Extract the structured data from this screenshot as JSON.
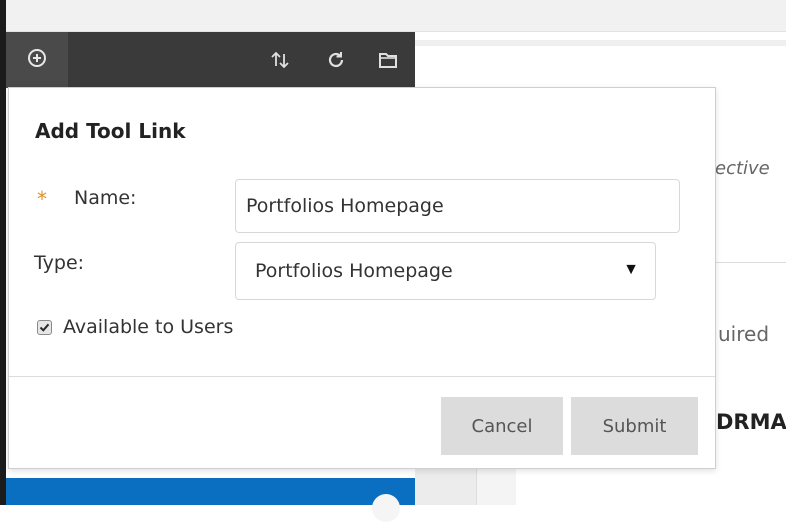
{
  "toolbar": {
    "icons": [
      "add-circle-icon",
      "sort-arrows-icon",
      "refresh-icon",
      "folder-icon"
    ]
  },
  "background_page": {
    "text_fragment_1": "ective",
    "text_fragment_2": "uired",
    "text_fragment_3": "DRMA"
  },
  "dialog": {
    "title": "Add Tool Link",
    "name_field": {
      "required_marker": "*",
      "label": "Name:",
      "value": "Portfolios Homepage"
    },
    "type_field": {
      "label": "Type:",
      "selected": "Portfolios Homepage",
      "arrow": "▼"
    },
    "available_checkbox": {
      "label": "Available to Users",
      "checked": true
    },
    "buttons": {
      "cancel": "Cancel",
      "submit": "Submit"
    }
  },
  "colors": {
    "toolbar_bg": "#3a3a3a",
    "required_star": "#e0902a",
    "sidebar_active": "#0a6ec1",
    "button_bg": "#dcdcdc"
  }
}
